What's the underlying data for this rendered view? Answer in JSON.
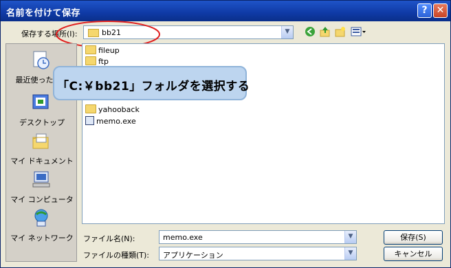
{
  "window": {
    "title": "名前を付けて保存",
    "help_label": "?",
    "close_label": "✕"
  },
  "location": {
    "label": "保存する場所(I):",
    "value": "bb21"
  },
  "places": [
    {
      "label": "最近使ったファ",
      "icon": "recent-icon"
    },
    {
      "label": "デスクトップ",
      "icon": "desktop-icon"
    },
    {
      "label": "マイ ドキュメント",
      "icon": "my-documents-icon"
    },
    {
      "label": "マイ コンピュータ",
      "icon": "my-computer-icon"
    },
    {
      "label": "マイ ネットワーク",
      "icon": "my-network-icon"
    }
  ],
  "files": [
    {
      "name": "fileup",
      "type": "folder"
    },
    {
      "name": "ftp",
      "type": "folder"
    },
    {
      "name": "yahooback",
      "type": "folder"
    },
    {
      "name": "memo.exe",
      "type": "exe"
    }
  ],
  "filename": {
    "label": "ファイル名(N):",
    "value": "memo.exe"
  },
  "filetype": {
    "label": "ファイルの種類(T):",
    "value": "アプリケーション"
  },
  "buttons": {
    "save": "保存(S)",
    "cancel": "キャンセル"
  },
  "callout": {
    "text": "「C:￥bb21」フォルダを選択する"
  },
  "colors": {
    "titlebar": "#0f3aa5",
    "highlight": "#e02020",
    "callout": "#bdd5ef"
  }
}
